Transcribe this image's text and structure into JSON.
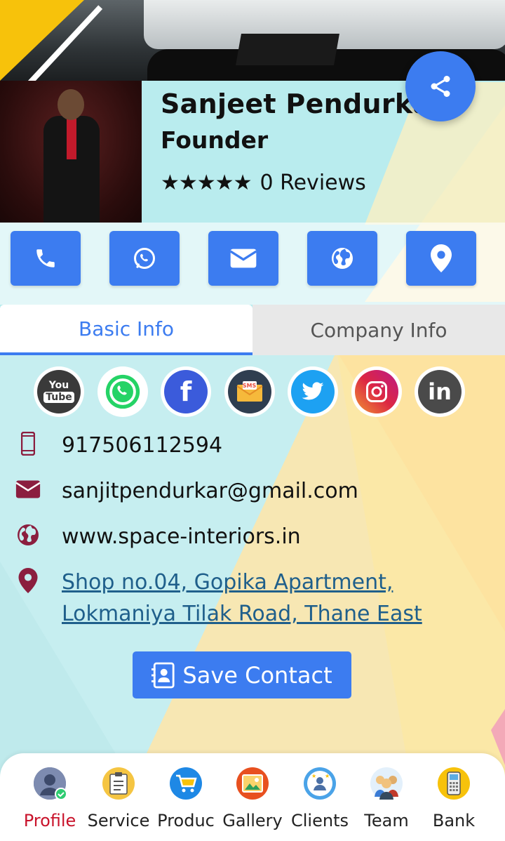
{
  "profile": {
    "name": "Sanjeet Pendurkar",
    "title": "Founder",
    "stars": "★★★★★",
    "reviews": "0 Reviews"
  },
  "actions": [
    {
      "name": "call-button",
      "icon": "phone-icon"
    },
    {
      "name": "whatsapp-button",
      "icon": "whatsapp-icon"
    },
    {
      "name": "email-button",
      "icon": "envelope-icon"
    },
    {
      "name": "website-button",
      "icon": "globe-icon"
    },
    {
      "name": "location-button",
      "icon": "map-pin-icon"
    }
  ],
  "tabs": [
    {
      "label": "Basic Info",
      "active": true
    },
    {
      "label": "Company Info",
      "active": false
    }
  ],
  "social": [
    {
      "name": "youtube",
      "label_top": "You",
      "label_bottom": "Tube",
      "color": "#3a3a3a"
    },
    {
      "name": "whatsapp",
      "color": "#25d366"
    },
    {
      "name": "facebook",
      "label": "f",
      "color": "#3b5bdb"
    },
    {
      "name": "sms",
      "label": "SMS",
      "color": "#2f3e50"
    },
    {
      "name": "twitter",
      "color": "#1da1f2"
    },
    {
      "name": "instagram",
      "color": "#c13584"
    },
    {
      "name": "linkedin",
      "label": "in",
      "color": "#4a4a4a"
    }
  ],
  "contact": {
    "phone": "917506112594",
    "email": "sanjitpendurkar@gmail.com",
    "website": "www.space-interiors.in",
    "address_line1": "Shop no.04, Gopika Apartment,",
    "address_line2": "Lokmaniya Tilak Road, Thane East"
  },
  "save_contact_label": "Save Contact",
  "nav": [
    {
      "label": "Profile",
      "icon": "profile-icon",
      "active": true
    },
    {
      "label": "Service",
      "icon": "service-icon"
    },
    {
      "label": "Produc",
      "icon": "cart-icon"
    },
    {
      "label": "Gallery",
      "icon": "gallery-icon"
    },
    {
      "label": "Clients",
      "icon": "clients-icon"
    },
    {
      "label": "Team",
      "icon": "team-icon"
    },
    {
      "label": "Bank",
      "icon": "bank-icon"
    }
  ],
  "colors": {
    "accent": "#3c7cf0",
    "icon_maroon": "#8b1e3f",
    "active_nav": "#c9132b"
  }
}
